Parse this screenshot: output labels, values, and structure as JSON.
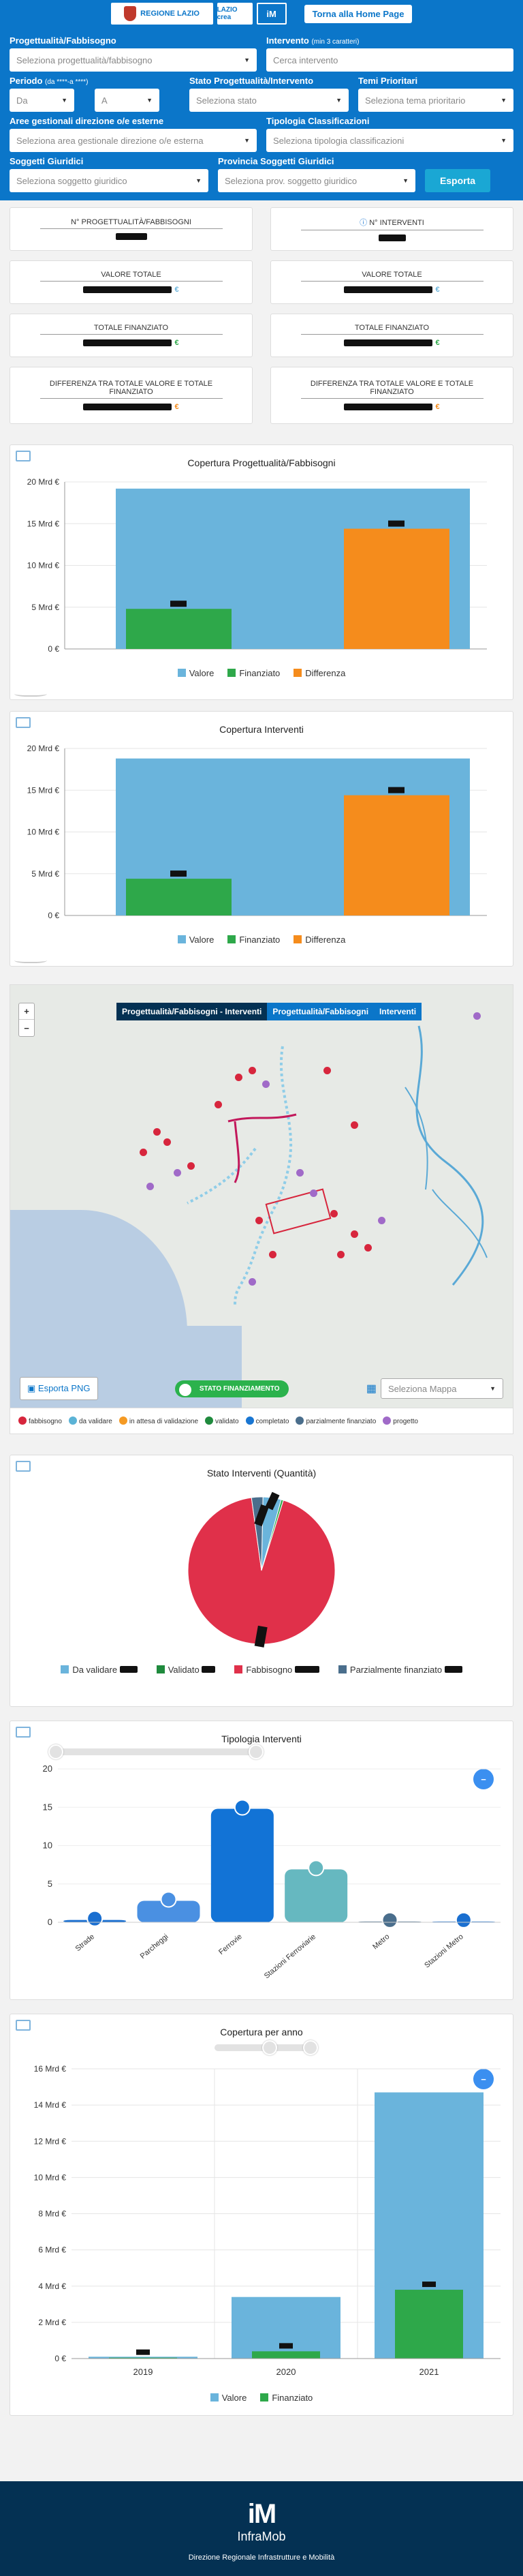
{
  "header": {
    "region_logo": "REGIONE LAZIO",
    "cresa_logo": "LAZIO crea",
    "infra_logo": "iM",
    "home_button": "Torna alla Home Page"
  },
  "filters": {
    "progettualita_label": "Progettualità/Fabbisogno",
    "progettualita_placeholder": "Seleziona progettualità/fabbisogno",
    "intervento_label": "Intervento",
    "intervento_note": "(min 3 caratteri)",
    "intervento_placeholder": "Cerca intervento",
    "periodo_label": "Periodo",
    "periodo_note": "(da ****-a ****)",
    "da_placeholder": "Da",
    "a_placeholder": "A",
    "stato_label": "Stato Progettualità/Intervento",
    "stato_placeholder": "Seleziona stato",
    "temi_label": "Temi Prioritari",
    "temi_placeholder": "Seleziona tema prioritario",
    "aree_label": "Aree gestionali direzione o/e esterne",
    "aree_placeholder": "Seleziona area gestionale direzione o/e esterna",
    "tipologia_label": "Tipologia Classificazioni",
    "tipologia_placeholder": "Seleziona tipologia classificazioni",
    "soggetti_label": "Soggetti Giuridici",
    "soggetti_placeholder": "Seleziona soggetto giuridico",
    "provincia_label": "Provincia Soggetti Giuridici",
    "provincia_placeholder": "Seleziona prov. soggetto giuridico",
    "export_button": "Esporta"
  },
  "kpis": {
    "n_progettualita": "N° PROGETTUALITÀ/FABBISOGNI",
    "n_interventi": "N° INTERVENTI",
    "valore_totale": "VALORE TOTALE",
    "totale_finanziato": "TOTALE FINANZIATO",
    "differenza": "DIFFERENZA TRA TOTALE VALORE E TOTALE FINANZIATO",
    "euro": "€"
  },
  "chart1_title": "Copertura Progettualità/Fabbisogni",
  "chart2_title": "Copertura Interventi",
  "legend_valore": "Valore",
  "legend_finanziato": "Finanziato",
  "legend_differenza": "Differenza",
  "map": {
    "tabs": [
      "Progettualità/Fabbisogni - Interventi",
      "Progettualità/Fabbisogni",
      "Interventi"
    ],
    "zoom_in": "+",
    "zoom_out": "−",
    "export_png": "Esporta PNG",
    "toggle_label": "STATO FINANZIAMENTO",
    "map_select_placeholder": "Seleziona Mappa",
    "legend": [
      {
        "label": "fabbisogno",
        "color": "#d7263d"
      },
      {
        "label": "da validare",
        "color": "#5bb3d6"
      },
      {
        "label": "in attesa di validazione",
        "color": "#f59a23"
      },
      {
        "label": "validato",
        "color": "#1f8a3d"
      },
      {
        "label": "completato",
        "color": "#1976d2"
      },
      {
        "label": "parzialmente finanziato",
        "color": "#4a6e8c"
      },
      {
        "label": "progetto",
        "color": "#a06ac8"
      }
    ]
  },
  "pie_title": "Stato Interventi (Quantità)",
  "pie_legend": [
    "Da validare",
    "Validato",
    "Fabbisogno",
    "Parzialmente finanziato"
  ],
  "tipologia_title": "Tipologia Interventi",
  "anno_title": "Copertura per anno",
  "footer": {
    "brand": "InfraMob",
    "subtitle": "Direzione Regionale Infrastrutture e Mobilità"
  },
  "chart_data": [
    {
      "type": "bar",
      "title": "Copertura Progettualità/Fabbisogni",
      "categories": [
        "Valore",
        "Finanziato",
        "Differenza"
      ],
      "values": [
        19.2,
        4.8,
        14.4
      ],
      "ylim": [
        0,
        20
      ],
      "yticks": [
        "0 €",
        "5 Mrd €",
        "10 Mrd €",
        "15 Mrd €",
        "20 Mrd €"
      ],
      "colors": [
        "#6ab4dc",
        "#2ea84a",
        "#f58c1c"
      ]
    },
    {
      "type": "bar",
      "title": "Copertura Interventi",
      "categories": [
        "Valore",
        "Finanziato",
        "Differenza"
      ],
      "values": [
        18.8,
        4.4,
        14.4
      ],
      "ylim": [
        0,
        20
      ],
      "yticks": [
        "0 €",
        "5 Mrd €",
        "10 Mrd €",
        "15 Mrd €",
        "20 Mrd €"
      ],
      "colors": [
        "#6ab4dc",
        "#2ea84a",
        "#f58c1c"
      ]
    },
    {
      "type": "pie",
      "title": "Stato Interventi (Quantità)",
      "categories": [
        "Da validare",
        "Validato",
        "Fabbisogno",
        "Parzialmente finanziato"
      ],
      "values": [
        4,
        0.5,
        93,
        2.5
      ],
      "colors": [
        "#6ab4dc",
        "#2ea84a",
        "#e0304a",
        "#4a6e8c"
      ]
    },
    {
      "type": "bar",
      "title": "Tipologia Interventi",
      "categories": [
        "Strade",
        "Parcheggi",
        "Ferrovie",
        "Stazioni Ferroviarie",
        "Metro",
        "Stazioni Metro"
      ],
      "values": [
        0.3,
        2.8,
        14.8,
        6.9,
        0.1,
        0.1
      ],
      "ylim": [
        0,
        20
      ],
      "yticks": [
        "0",
        "5",
        "10",
        "15",
        "20"
      ],
      "colors": [
        "#1a6fd0",
        "#4a90e2",
        "#1273d6",
        "#66b8c0",
        "#4a6e8c",
        "#1a6fd0"
      ]
    },
    {
      "type": "bar",
      "title": "Copertura per anno",
      "categories": [
        "2019",
        "2020",
        "2021"
      ],
      "series": [
        {
          "name": "Valore",
          "values": [
            0.1,
            3.4,
            14.7
          ]
        },
        {
          "name": "Finanziato",
          "values": [
            0.05,
            0.4,
            3.8
          ]
        }
      ],
      "ylim": [
        0,
        16
      ],
      "yticks": [
        "0 €",
        "2 Mrd €",
        "4 Mrd €",
        "6 Mrd €",
        "8 Mrd €",
        "10 Mrd €",
        "12 Mrd €",
        "14 Mrd €",
        "16 Mrd €"
      ],
      "colors": [
        "#6ab4dc",
        "#2ea84a"
      ]
    }
  ]
}
